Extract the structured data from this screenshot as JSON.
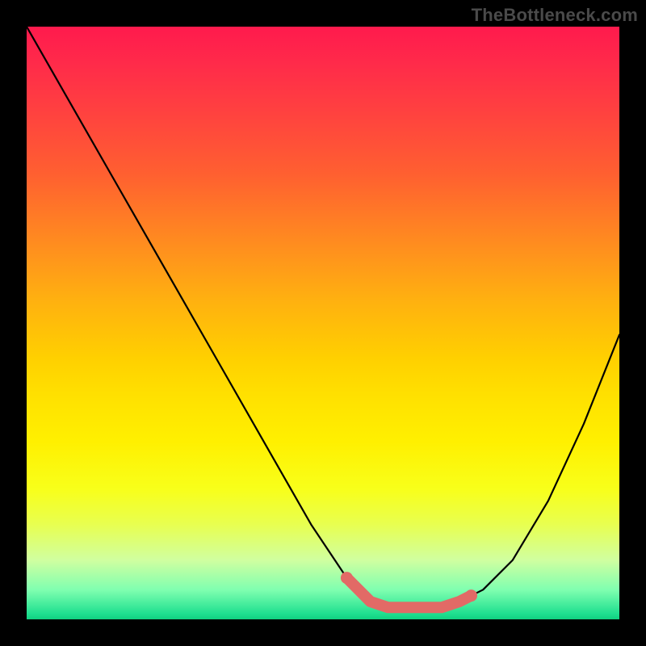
{
  "watermark": "TheBottleneck.com",
  "colors": {
    "frame": "#000000",
    "curve": "#000000",
    "marker": "#e26a66",
    "gradient_top": "#ff1a4d",
    "gradient_bottom": "#10d080"
  },
  "chart_data": {
    "type": "line",
    "title": "",
    "xlabel": "",
    "ylabel": "",
    "xlim": [
      0,
      100
    ],
    "ylim": [
      0,
      100
    ],
    "grid": false,
    "legend": false,
    "series": [
      {
        "name": "curve",
        "x": [
          0,
          8,
          16,
          24,
          32,
          40,
          48,
          54,
          58,
          61,
          64,
          67,
          70,
          73,
          77,
          82,
          88,
          94,
          100
        ],
        "y": [
          100,
          86,
          72,
          58,
          44,
          30,
          16,
          7,
          3,
          2,
          2,
          2,
          2,
          3,
          5,
          10,
          20,
          33,
          48
        ]
      }
    ],
    "markers": {
      "name": "highlight-dots",
      "color": "#e26a66",
      "x": [
        54,
        58,
        61,
        64,
        67,
        70,
        73,
        75
      ],
      "y": [
        7,
        3.0,
        2.0,
        2.0,
        2.0,
        2.0,
        3.0,
        4.0
      ]
    }
  }
}
